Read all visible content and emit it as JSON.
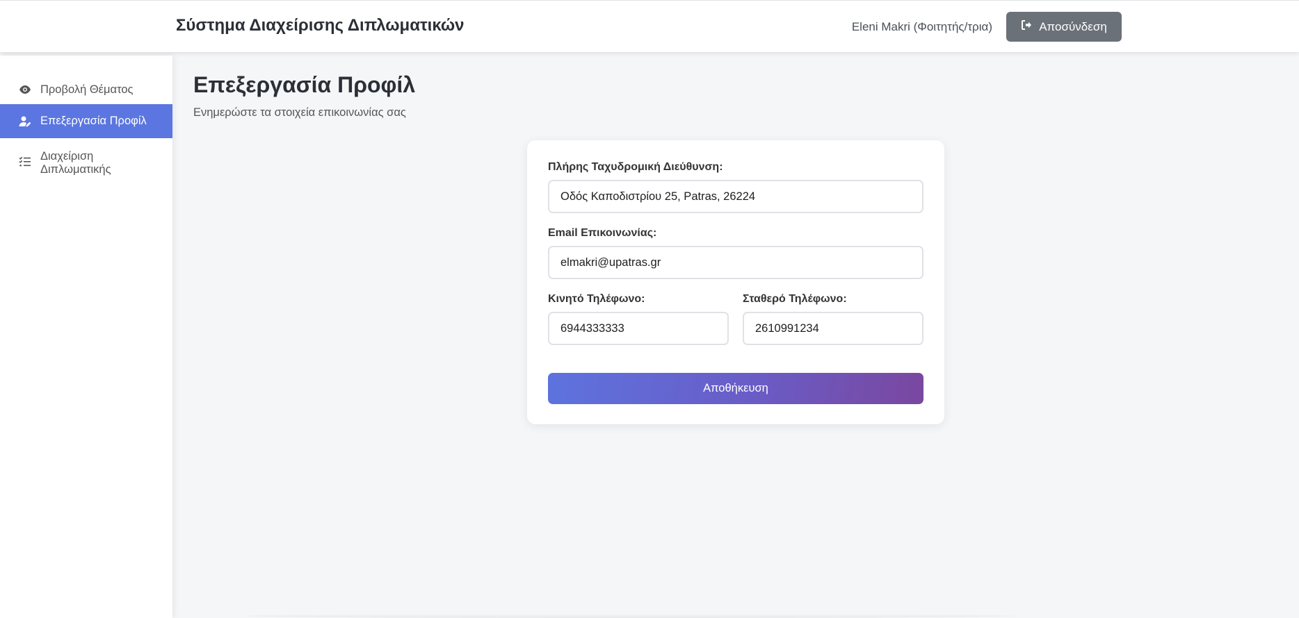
{
  "header": {
    "app_title": "Σύστημα Διαχείρισης Διπλωματικών",
    "user_label": "Eleni Makri (Φοιτητής/τρια)",
    "logout_label": "Αποσύνδεση",
    "logout_icon": "sign-out-icon"
  },
  "sidebar": {
    "items": [
      {
        "label": "Προβολή Θέματος",
        "icon": "eye-icon",
        "active": false
      },
      {
        "label": "Επεξεργασία Προφίλ",
        "icon": "user-edit-icon",
        "active": true
      },
      {
        "label": "Διαχείριση Διπλωματικής",
        "icon": "list-check-icon",
        "active": false
      }
    ]
  },
  "main": {
    "title": "Επεξεργασία Προφίλ",
    "subtitle": "Ενημερώστε τα στοιχεία επικοινωνίας σας"
  },
  "form": {
    "address": {
      "label": "Πλήρης Ταχυδρομική Διεύθυνση:",
      "value": "Οδός Καποδιστρίου 25, Patras, 26224"
    },
    "email": {
      "label": "Email Επικοινωνίας:",
      "value": "elmakri@upatras.gr"
    },
    "mobile": {
      "label": "Κινητό Τηλέφωνο:",
      "value": "6944333333"
    },
    "landline": {
      "label": "Σταθερό Τηλέφωνο:",
      "value": "2610991234"
    },
    "save_label": "Αποθήκευση"
  },
  "colors": {
    "accent": "#5b76e0",
    "logout_button": "#6b7178",
    "save_gradient_start": "#5d73df",
    "save_gradient_end": "#7a479f"
  }
}
